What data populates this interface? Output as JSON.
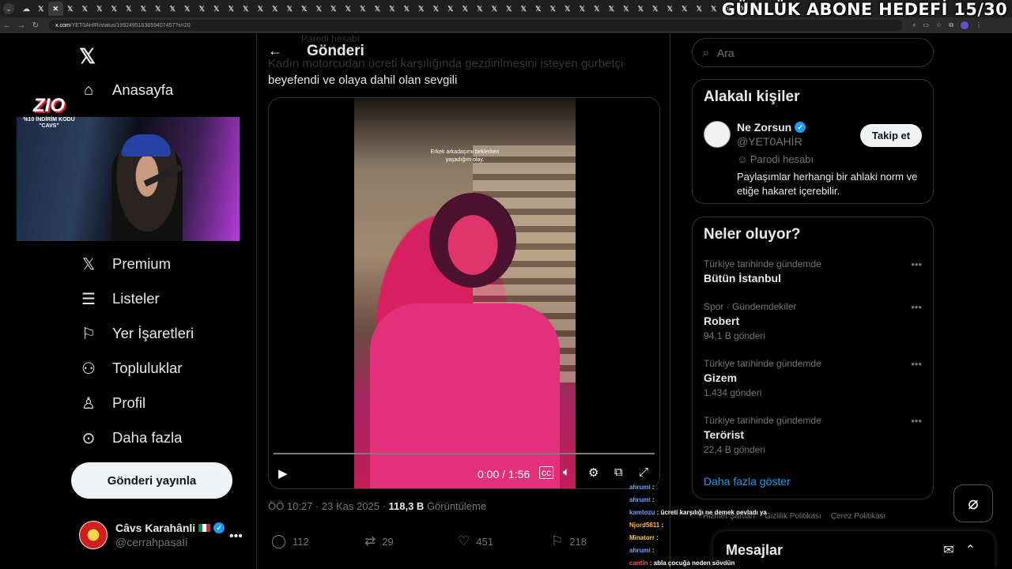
{
  "overlay": {
    "goal": "GÜNLÜK ABONE HEDEFİ 15/30"
  },
  "browser": {
    "url_host": "x.com",
    "url_path": "/YET0AHIR/status/1992495163659407457?s=20"
  },
  "nav": {
    "home": "Anasayfa",
    "premium": "Premium",
    "lists": "Listeler",
    "bookmarks": "Yer İşaretleri",
    "communities": "Topluluklar",
    "profile": "Profil",
    "more": "Daha fazla",
    "post_button": "Gönderi yayınla"
  },
  "account": {
    "name": "Câvs Karahânli",
    "handle": "@cerrahpasaİi"
  },
  "stream_logo": {
    "brand": "ZIO",
    "code_line1": "%10 İNDİRİM KODU",
    "code_line2": "\"CAVS\""
  },
  "post": {
    "header": "Gönderi",
    "ghost_top": "Parodi hesabı",
    "ghost_line": "Kadın motorcudan ücreti karşılığında gezdirilmesini isteyen gurbetçi",
    "text": "beyefendi ve olaya dahil olan sevgili",
    "video_caption_1": "Erkek arkadaşımı beklerken",
    "video_caption_2": "yaşadığım olay.",
    "video_time": "0:00 / 1:56",
    "timestamp": "ÖÖ 10:27 · 23 Kas 2025 · ",
    "views_value": "118,3 B",
    "views_label": " Görüntüleme",
    "replies": "112",
    "reposts": "29",
    "likes": "451",
    "bookmarks": "218"
  },
  "right": {
    "search_placeholder": "Ara",
    "related_title": "Alakalı kişiler",
    "related_name": "Ne Zorsun",
    "related_handle": "@YET0AHİR",
    "related_badge": "Parodi hesabı",
    "related_bio": "Paylaşımlar herhangi bir ahlaki norm ve etiğe hakaret içerebilir.",
    "follow_label": "Takip et",
    "trends_title": "Neler oluyor?",
    "trends": [
      {
        "category": "Türkiye tarihinde gündemde",
        "name": "Bütün İstanbul",
        "count": ""
      },
      {
        "category": "Spor · Gündemdekiler",
        "name": "Robert",
        "count": "94,1 B gönderi"
      },
      {
        "category": "Türkiye tarihinde gündemde",
        "name": "Gizem",
        "count": "1.434 gönderi"
      },
      {
        "category": "Türkiye tarihinde gündemde",
        "name": "Terörist",
        "count": "22,4 B gönderi"
      }
    ],
    "show_more": "Daha fazla göster",
    "footer": [
      "Hizmet Şartları",
      "Gizlilik Politikası",
      "Çerez Politikası"
    ],
    "messages": "Mesajlar"
  },
  "chat": [
    {
      "user": "ahrumi",
      "text": ""
    },
    {
      "user": "ahrumi",
      "text": ""
    },
    {
      "user": "kamtozu",
      "text": "ücreti karşılığı ne demek oevladı ya"
    },
    {
      "user": "Njord5811",
      "text": ""
    },
    {
      "user": "Minatorr",
      "text": ""
    },
    {
      "user": "ahrumi",
      "text": ""
    },
    {
      "user": "cantin",
      "text": "abla çocuğa neden sövdün"
    }
  ]
}
